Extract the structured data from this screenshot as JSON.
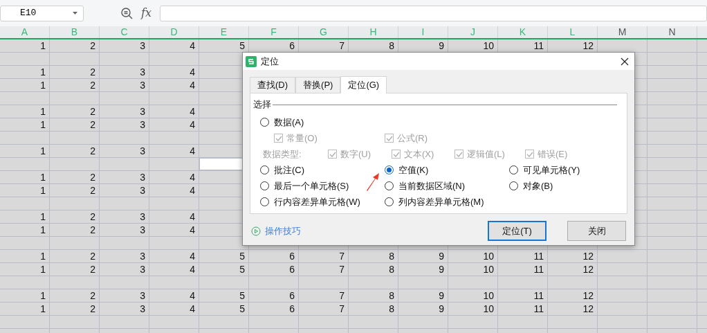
{
  "name_box": {
    "value": "E10"
  },
  "formula_bar": {
    "fx": "fx"
  },
  "columns": [
    {
      "label": "A",
      "selected": true
    },
    {
      "label": "B",
      "selected": true
    },
    {
      "label": "C",
      "selected": true
    },
    {
      "label": "D",
      "selected": true
    },
    {
      "label": "E",
      "selected": true,
      "active": true
    },
    {
      "label": "F",
      "selected": true
    },
    {
      "label": "G",
      "selected": true
    },
    {
      "label": "H",
      "selected": true
    },
    {
      "label": "I",
      "selected": true
    },
    {
      "label": "J",
      "selected": true
    },
    {
      "label": "K",
      "selected": true
    },
    {
      "label": "L",
      "selected": true
    },
    {
      "label": "M",
      "selected": false
    },
    {
      "label": "N",
      "selected": false
    }
  ],
  "rows": [
    {
      "kind": "data",
      "cells": [
        "1",
        "2",
        "3",
        "4",
        "5",
        "6",
        "7",
        "8",
        "9",
        "10",
        "11",
        "12"
      ]
    },
    {
      "kind": "blank"
    },
    {
      "kind": "data",
      "cells": [
        "1",
        "2",
        "3",
        "4"
      ]
    },
    {
      "kind": "data",
      "cells": [
        "1",
        "2",
        "3",
        "4"
      ]
    },
    {
      "kind": "blank"
    },
    {
      "kind": "data",
      "cells": [
        "1",
        "2",
        "3",
        "4"
      ]
    },
    {
      "kind": "data",
      "cells": [
        "1",
        "2",
        "3",
        "4"
      ]
    },
    {
      "kind": "blank"
    },
    {
      "kind": "data",
      "cells": [
        "1",
        "2",
        "3",
        "4"
      ]
    },
    {
      "kind": "blank",
      "has_active_cell": true
    },
    {
      "kind": "data",
      "cells": [
        "1",
        "2",
        "3",
        "4"
      ]
    },
    {
      "kind": "data",
      "cells": [
        "1",
        "2",
        "3",
        "4"
      ]
    },
    {
      "kind": "blank"
    },
    {
      "kind": "data",
      "cells": [
        "1",
        "2",
        "3",
        "4"
      ]
    },
    {
      "kind": "data",
      "cells": [
        "1",
        "2",
        "3",
        "4"
      ]
    },
    {
      "kind": "blank"
    },
    {
      "kind": "data",
      "cells": [
        "1",
        "2",
        "3",
        "4",
        "5",
        "6",
        "7",
        "8",
        "9",
        "10",
        "11",
        "12"
      ]
    },
    {
      "kind": "data",
      "cells": [
        "1",
        "2",
        "3",
        "4",
        "5",
        "6",
        "7",
        "8",
        "9",
        "10",
        "11",
        "12"
      ]
    },
    {
      "kind": "blank"
    },
    {
      "kind": "data",
      "cells": [
        "1",
        "2",
        "3",
        "4",
        "5",
        "6",
        "7",
        "8",
        "9",
        "10",
        "11",
        "12"
      ]
    },
    {
      "kind": "data",
      "cells": [
        "1",
        "2",
        "3",
        "4",
        "5",
        "6",
        "7",
        "8",
        "9",
        "10",
        "11",
        "12"
      ]
    },
    {
      "kind": "blank"
    },
    {
      "kind": "blank"
    }
  ],
  "dialog": {
    "title": "定位",
    "tabs": [
      {
        "label": "查找(D)",
        "selected": false
      },
      {
        "label": "替换(P)",
        "selected": false
      },
      {
        "label": "定位(G)",
        "selected": true
      }
    ],
    "group_label": "选择",
    "data_option": {
      "label": "数据(A)",
      "selected": false,
      "sub_options": [
        {
          "label": "常量(O)",
          "checked": true,
          "disabled": true
        },
        {
          "label": "公式(R)",
          "checked": true,
          "disabled": true
        }
      ],
      "type_label": "数据类型:",
      "types": [
        {
          "label": "数字(U)",
          "checked": true,
          "disabled": true
        },
        {
          "label": "文本(X)",
          "checked": true,
          "disabled": true
        },
        {
          "label": "逻辑值(L)",
          "checked": true,
          "disabled": true
        },
        {
          "label": "错误(E)",
          "checked": true,
          "disabled": true
        }
      ]
    },
    "options": [
      {
        "label": "批注(C)",
        "selected": false
      },
      {
        "label": "空值(K)",
        "selected": true
      },
      {
        "label": "可见单元格(Y)",
        "selected": false
      },
      {
        "label": "最后一个单元格(S)",
        "selected": false
      },
      {
        "label": "当前数据区域(N)",
        "selected": false
      },
      {
        "label": "对象(B)",
        "selected": false
      },
      {
        "label": "行内容差异单元格(W)",
        "selected": false
      },
      {
        "label": "列内容差异单元格(M)",
        "selected": false
      }
    ],
    "tips_link": "操作技巧",
    "buttons": [
      {
        "label": "定位(T)",
        "default": true
      },
      {
        "label": "关闭",
        "default": false
      }
    ]
  }
}
